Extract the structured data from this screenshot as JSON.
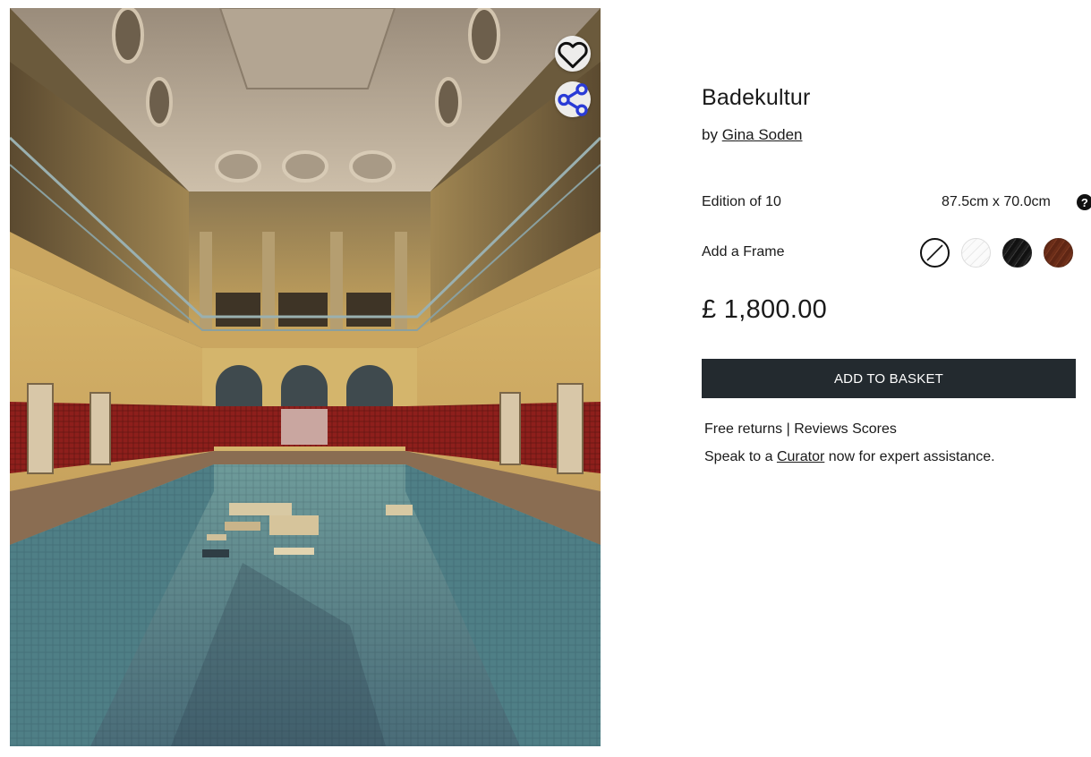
{
  "artwork": {
    "title": "Badekultur",
    "by_prefix": "by",
    "artist": "Gina Soden",
    "edition": "Edition of 10",
    "size": "87.5cm x 70.0cm",
    "size_help": "?",
    "frame_label": "Add a Frame",
    "frame_options": [
      {
        "name": "no-frame",
        "color": "#ffffff"
      },
      {
        "name": "white-frame",
        "color": "#f2f2f2"
      },
      {
        "name": "black-frame",
        "color": "#1c1c1c"
      },
      {
        "name": "brown-frame",
        "color": "#6b2d18"
      }
    ],
    "price": "£ 1,800.00"
  },
  "actions": {
    "add_to_basket": "ADD TO BASKET",
    "favourite_icon": "heart-icon",
    "share_icon": "share-icon"
  },
  "info": {
    "free_returns": "Free returns",
    "separator": " | ",
    "reviews": "Reviews Scores",
    "speak_prefix": "Speak to a ",
    "curator": "Curator",
    "speak_suffix": " now for expert assistance."
  },
  "colors": {
    "button_bg": "#232a2f",
    "share_icon": "#2a3bd6"
  }
}
